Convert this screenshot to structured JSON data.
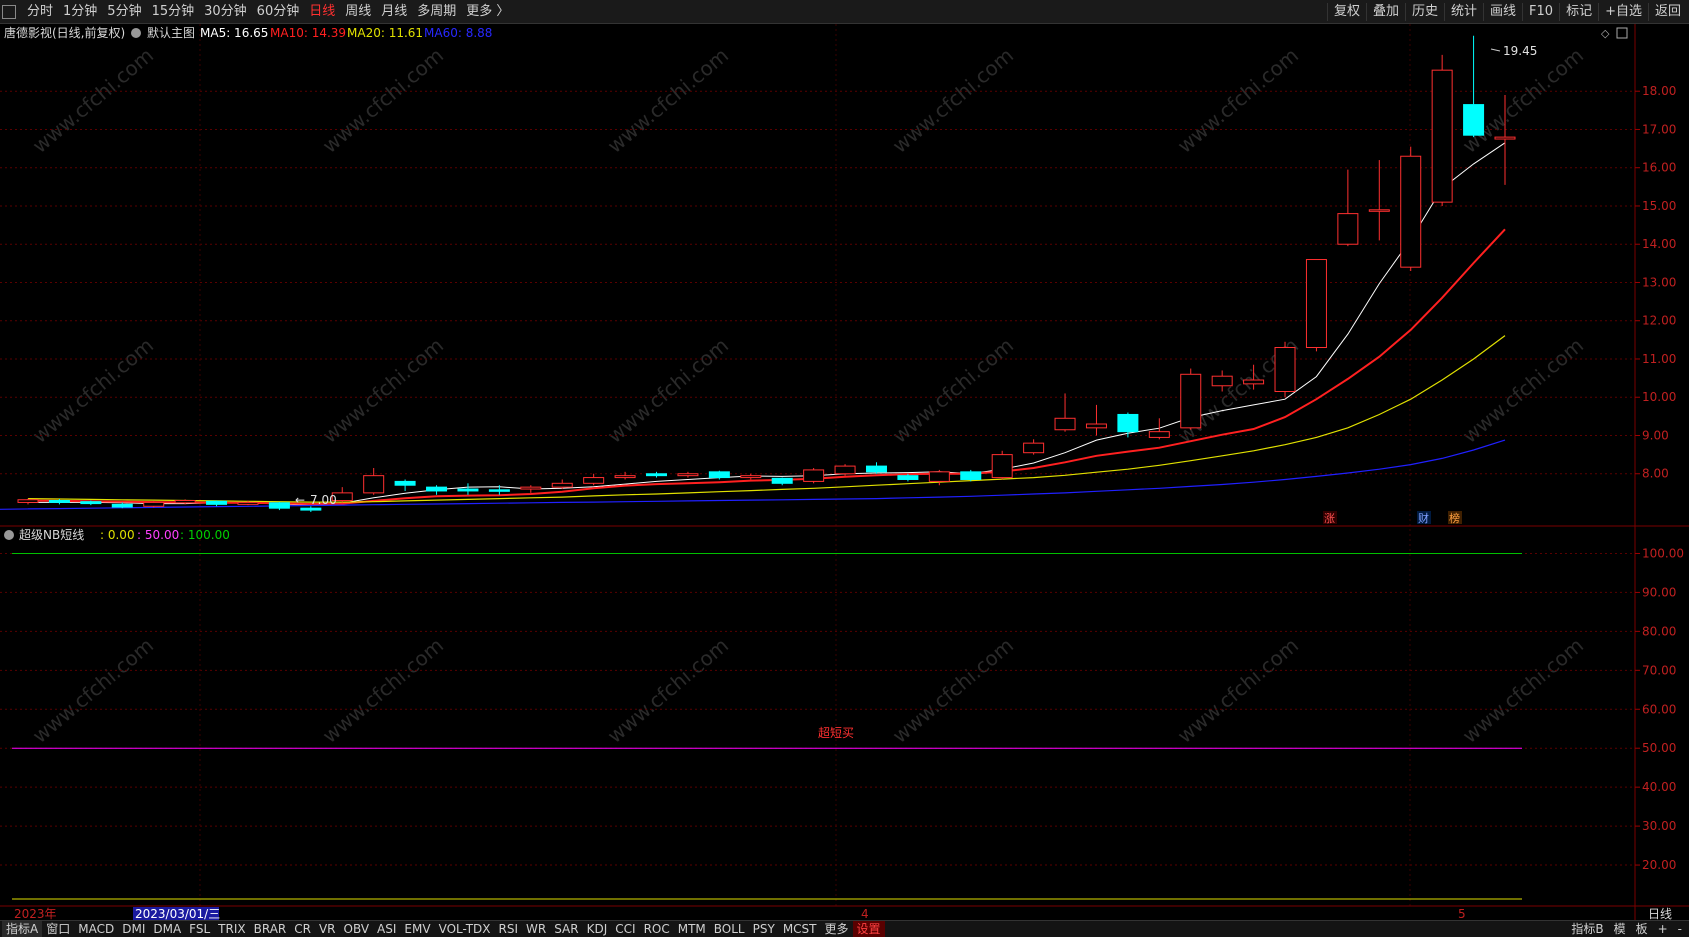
{
  "toolbar": {
    "periods": [
      "分时",
      "1分钟",
      "5分钟",
      "15分钟",
      "30分钟",
      "60分钟",
      "日线",
      "周线",
      "月线",
      "多周期",
      "更多 〉"
    ],
    "active_period": "日线",
    "right_buttons": [
      "复权",
      "叠加",
      "历史",
      "统计",
      "画线",
      "F10",
      "标记",
      "+自选",
      "返回"
    ]
  },
  "chart_header": {
    "stock": "唐德影视(日线,前复权)",
    "main_label": "默认主图",
    "ma5": "MA5: 16.65",
    "ma10": "MA10: 14.39",
    "ma20": "MA20: 11.61",
    "ma60": "MA60: 8.88"
  },
  "sub_header": {
    "name": "超级NB短线",
    "v1": ": 0.00",
    "v2": ": 50.00",
    "v3": ": 100.00",
    "mid_label": "超短买"
  },
  "date_axis": {
    "start": "2023年",
    "cursor_date": "2023/03/01/三",
    "month4": "4",
    "month5": "5",
    "period_label": "日线"
  },
  "markers": {
    "zhang": "涨",
    "cai1": "财",
    "cai2": "榜"
  },
  "bottom_tabs": [
    "指标A",
    "窗口",
    "MACD",
    "DMI",
    "DMA",
    "FSL",
    "TRIX",
    "BRAR",
    "CR",
    "VR",
    "OBV",
    "ASI",
    "EMV",
    "VOL-TDX",
    "RSI",
    "WR",
    "SAR",
    "KDJ",
    "CCI",
    "ROC",
    "MTM",
    "BOLL",
    "PSY",
    "MCST",
    "更多",
    "设置"
  ],
  "bottom_right": [
    "指标B",
    "模",
    "板",
    "+",
    "-"
  ],
  "watermark": "www.cfchi.com",
  "colors": {
    "up": "#ff3030",
    "down": "#00ffff",
    "ma5": "#ffffff",
    "ma10": "#ff2020",
    "ma20": "#e0e000",
    "ma60": "#2020ff",
    "grid": "#5a0000"
  },
  "chart_data": {
    "type": "candlestick",
    "price_ylim": [
      7.0,
      19.6
    ],
    "price_ticks": [
      "18.00",
      "17.00",
      "16.00",
      "15.00",
      "14.00",
      "13.00",
      "12.00",
      "11.00",
      "10.00",
      "9.00",
      "8.00"
    ],
    "max_label": "19.45",
    "min_label": "7.00",
    "candles": [
      {
        "o": 7.25,
        "c": 7.32,
        "h": 7.35,
        "l": 7.2
      },
      {
        "o": 7.3,
        "c": 7.25,
        "h": 7.34,
        "l": 7.2
      },
      {
        "o": 7.27,
        "c": 7.22,
        "h": 7.3,
        "l": 7.18
      },
      {
        "o": 7.2,
        "c": 7.13,
        "h": 7.25,
        "l": 7.1
      },
      {
        "o": 7.15,
        "c": 7.25,
        "h": 7.28,
        "l": 7.12
      },
      {
        "o": 7.24,
        "c": 7.3,
        "h": 7.33,
        "l": 7.2
      },
      {
        "o": 7.28,
        "c": 7.2,
        "h": 7.3,
        "l": 7.15
      },
      {
        "o": 7.2,
        "c": 7.25,
        "h": 7.3,
        "l": 7.18
      },
      {
        "o": 7.24,
        "c": 7.1,
        "h": 7.26,
        "l": 7.05
      },
      {
        "o": 7.1,
        "c": 7.05,
        "h": 7.15,
        "l": 7.0
      },
      {
        "o": 7.3,
        "c": 7.5,
        "h": 7.65,
        "l": 7.25
      },
      {
        "o": 7.5,
        "c": 7.95,
        "h": 8.15,
        "l": 7.45
      },
      {
        "o": 7.8,
        "c": 7.7,
        "h": 7.85,
        "l": 7.55
      },
      {
        "o": 7.65,
        "c": 7.55,
        "h": 7.7,
        "l": 7.45
      },
      {
        "o": 7.6,
        "c": 7.55,
        "h": 7.75,
        "l": 7.45
      },
      {
        "o": 7.58,
        "c": 7.55,
        "h": 7.7,
        "l": 7.45
      },
      {
        "o": 7.6,
        "c": 7.65,
        "h": 7.7,
        "l": 7.5
      },
      {
        "o": 7.65,
        "c": 7.75,
        "h": 7.85,
        "l": 7.6
      },
      {
        "o": 7.75,
        "c": 7.9,
        "h": 8.0,
        "l": 7.7
      },
      {
        "o": 7.9,
        "c": 7.95,
        "h": 8.05,
        "l": 7.85
      },
      {
        "o": 8.0,
        "c": 7.95,
        "h": 8.05,
        "l": 7.9
      },
      {
        "o": 7.95,
        "c": 8.0,
        "h": 8.05,
        "l": 7.9
      },
      {
        "o": 8.05,
        "c": 7.9,
        "h": 8.08,
        "l": 7.85
      },
      {
        "o": 7.9,
        "c": 7.95,
        "h": 8.0,
        "l": 7.85
      },
      {
        "o": 7.88,
        "c": 7.75,
        "h": 7.9,
        "l": 7.7
      },
      {
        "o": 7.8,
        "c": 8.1,
        "h": 8.15,
        "l": 7.75
      },
      {
        "o": 8.0,
        "c": 8.2,
        "h": 8.25,
        "l": 7.95
      },
      {
        "o": 8.2,
        "c": 8.05,
        "h": 8.3,
        "l": 8.0
      },
      {
        "o": 7.95,
        "c": 7.85,
        "h": 8.0,
        "l": 7.8
      },
      {
        "o": 7.8,
        "c": 8.05,
        "h": 8.1,
        "l": 7.7
      },
      {
        "o": 8.05,
        "c": 7.85,
        "h": 8.1,
        "l": 7.8
      },
      {
        "o": 7.9,
        "c": 8.5,
        "h": 8.6,
        "l": 7.85
      },
      {
        "o": 8.55,
        "c": 8.8,
        "h": 8.9,
        "l": 8.5
      },
      {
        "o": 9.15,
        "c": 9.45,
        "h": 10.1,
        "l": 9.1
      },
      {
        "o": 9.2,
        "c": 9.3,
        "h": 9.8,
        "l": 9.0
      },
      {
        "o": 9.55,
        "c": 9.1,
        "h": 9.6,
        "l": 8.95
      },
      {
        "o": 8.95,
        "c": 9.1,
        "h": 9.45,
        "l": 8.9
      },
      {
        "o": 9.2,
        "c": 10.6,
        "h": 10.75,
        "l": 9.15
      },
      {
        "o": 10.3,
        "c": 10.55,
        "h": 10.7,
        "l": 10.15
      },
      {
        "o": 10.35,
        "c": 10.45,
        "h": 10.85,
        "l": 10.2
      },
      {
        "o": 10.15,
        "c": 11.3,
        "h": 11.45,
        "l": 10.0
      },
      {
        "o": 11.3,
        "c": 13.6,
        "h": 13.6,
        "l": 11.2
      },
      {
        "o": 14.0,
        "c": 14.8,
        "h": 15.95,
        "l": 13.95
      },
      {
        "o": 14.9,
        "c": 14.9,
        "h": 16.2,
        "l": 14.1
      },
      {
        "o": 13.4,
        "c": 16.3,
        "h": 16.55,
        "l": 13.3
      },
      {
        "o": 15.1,
        "c": 18.55,
        "h": 18.95,
        "l": 15.0
      },
      {
        "o": 17.65,
        "c": 16.85,
        "h": 19.45,
        "l": 16.8
      },
      {
        "o": 16.75,
        "c": 16.8,
        "h": 17.9,
        "l": 15.55
      }
    ],
    "ma_series": [
      {
        "name": "MA5",
        "values": [
          7.25,
          7.25,
          7.25,
          7.24,
          7.22,
          7.22,
          7.24,
          7.24,
          7.21,
          7.18,
          7.23,
          7.37,
          7.49,
          7.58,
          7.65,
          7.66,
          7.6,
          7.62,
          7.66,
          7.73,
          7.8,
          7.85,
          7.9,
          7.94,
          7.93,
          7.95,
          8.0,
          8.02,
          8.03,
          8.05,
          8.0,
          8.12,
          8.28,
          8.55,
          8.88,
          9.06,
          9.19,
          9.47,
          9.65,
          9.8,
          9.95,
          10.54,
          11.65,
          12.97,
          14.12,
          15.46,
          16.1,
          16.65
        ]
      },
      {
        "name": "MA10",
        "values": [
          7.3,
          7.29,
          7.28,
          7.27,
          7.26,
          7.25,
          7.24,
          7.24,
          7.23,
          7.21,
          7.22,
          7.29,
          7.36,
          7.41,
          7.43,
          7.44,
          7.47,
          7.53,
          7.62,
          7.69,
          7.73,
          7.75,
          7.78,
          7.82,
          7.84,
          7.87,
          7.92,
          7.96,
          7.99,
          8.0,
          8.0,
          8.06,
          8.15,
          8.3,
          8.47,
          8.58,
          8.68,
          8.85,
          9.02,
          9.17,
          9.48,
          9.95,
          10.48,
          11.06,
          11.76,
          12.6,
          13.51,
          14.39
        ]
      },
      {
        "name": "MA20",
        "values": [
          7.35,
          7.34,
          7.33,
          7.32,
          7.31,
          7.3,
          7.29,
          7.28,
          7.27,
          7.26,
          7.26,
          7.27,
          7.29,
          7.31,
          7.33,
          7.35,
          7.37,
          7.39,
          7.42,
          7.45,
          7.47,
          7.5,
          7.53,
          7.56,
          7.59,
          7.62,
          7.66,
          7.7,
          7.74,
          7.78,
          7.82,
          7.86,
          7.9,
          7.96,
          8.04,
          8.12,
          8.22,
          8.34,
          8.47,
          8.6,
          8.76,
          8.95,
          9.2,
          9.55,
          9.95,
          10.45,
          11.0,
          11.61
        ]
      },
      {
        "name": "MA60",
        "values": [
          7.08,
          7.09,
          7.1,
          7.11,
          7.12,
          7.13,
          7.14,
          7.15,
          7.16,
          7.17,
          7.18,
          7.19,
          7.2,
          7.21,
          7.22,
          7.23,
          7.24,
          7.25,
          7.26,
          7.27,
          7.28,
          7.29,
          7.3,
          7.31,
          7.32,
          7.33,
          7.34,
          7.35,
          7.37,
          7.39,
          7.41,
          7.44,
          7.47,
          7.5,
          7.54,
          7.58,
          7.62,
          7.67,
          7.72,
          7.78,
          7.85,
          7.93,
          8.02,
          8.12,
          8.24,
          8.4,
          8.62,
          8.88
        ]
      }
    ],
    "indicator": {
      "ylim": [
        10,
        105
      ],
      "ticks": [
        "100.00",
        "90.00",
        "80.00",
        "70.00",
        "60.00",
        "50.00",
        "40.00",
        "30.00",
        "20.00"
      ],
      "lines": [
        {
          "value": 100,
          "color": "#00c000"
        },
        {
          "value": 50,
          "color": "#ff00ff"
        },
        {
          "value": 0,
          "color": "#e0e000"
        }
      ]
    }
  }
}
